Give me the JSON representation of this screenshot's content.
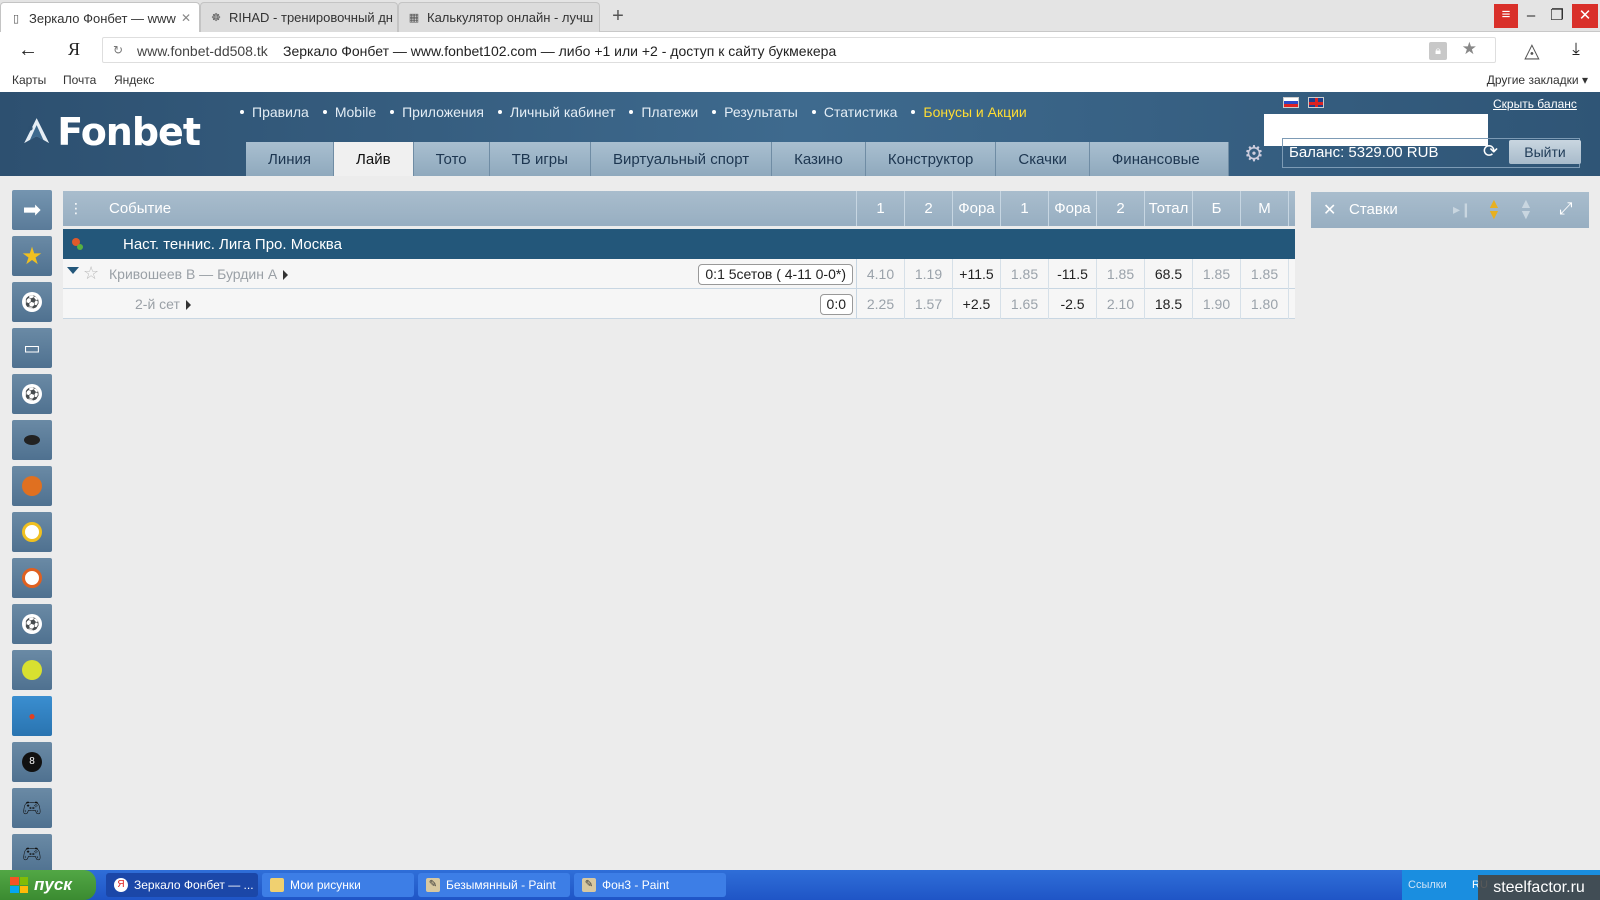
{
  "browser": {
    "tabs": [
      {
        "title": "Зеркало Фонбет — www"
      },
      {
        "title": "RIHAD - тренировочный дн"
      },
      {
        "title": "Калькулятор онлайн - лучш"
      }
    ],
    "new_tab": "+",
    "url_domain": "www.fonbet-dd508.tk",
    "url_title": "Зеркало Фонбет — www.fonbet102.com — либо +1 или +2 - доступ к сайту букмекера",
    "yandex_logo": "Я",
    "bookmarks": [
      "Карты",
      "Почта",
      "Яндекс"
    ],
    "bookmarks_other": "Другие закладки ▾"
  },
  "site": {
    "logo_text": "Fonbet",
    "top_links": [
      "Правила",
      "Mobile",
      "Приложения",
      "Личный кабинет",
      "Платежи",
      "Результаты",
      "Статистика"
    ],
    "top_link_bonus": "Бонусы и Акции",
    "nav_tabs": [
      "Линия",
      "Лайв",
      "Тото",
      "ТВ игры",
      "Виртуальный спорт",
      "Казино",
      "Конструктор",
      "Скачки",
      "Финансовые"
    ],
    "active_nav": "Лайв",
    "hide_balance": "Скрыть баланс",
    "balance": "Баланс: 5329.00 RUB",
    "logout": "Выйти",
    "accent_color": "#ffdd33"
  },
  "events": {
    "header": {
      "event": "Событие",
      "cols": [
        "1",
        "2",
        "Фора",
        "1",
        "Фора",
        "2",
        "Тотал",
        "Б",
        "М"
      ]
    },
    "league": "Наст. теннис. Лига Про. Москва",
    "rows": [
      {
        "name": "Кривошеев В — Бурдин А",
        "score": "0:1 5сетов ( 4-11 0-0*)",
        "cells": [
          "4.10",
          "1.19",
          "+11.5",
          "1.85",
          "-11.5",
          "1.85",
          "68.5",
          "1.85",
          "1.85"
        ]
      },
      {
        "name": "2-й сет",
        "score": "0:0",
        "cells": [
          "2.25",
          "1.57",
          "+2.5",
          "1.65",
          "-2.5",
          "2.10",
          "18.5",
          "1.90",
          "1.80"
        ]
      }
    ]
  },
  "bets": {
    "label": "Ставки"
  },
  "taskbar": {
    "start": "пуск",
    "tasks": [
      "Зеркало Фонбет — ...",
      "Мои рисунки",
      "Безымянный - Paint",
      "Фон3 - Paint"
    ],
    "tray_links": "Ссылки",
    "tray_lang": "RU"
  },
  "watermark": "steelfactor.ru"
}
